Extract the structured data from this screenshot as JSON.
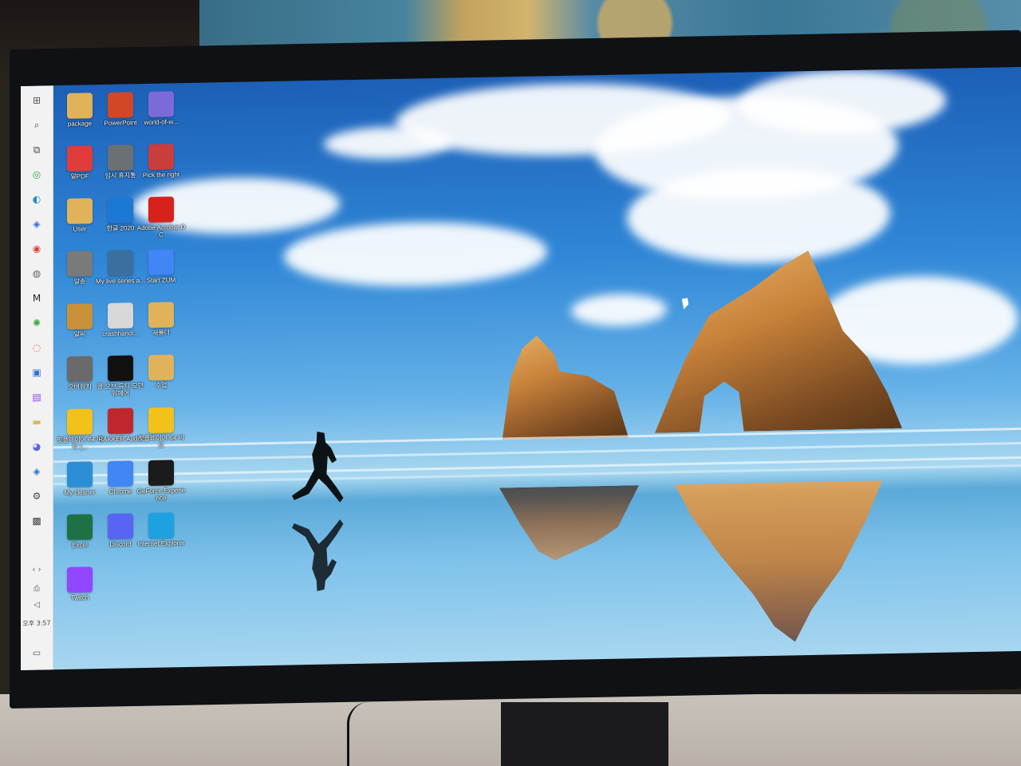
{
  "desktop": {
    "icons": [
      {
        "label": "package",
        "icon": "folder-icon",
        "color": "#e0b35a"
      },
      {
        "label": "PowerPoint",
        "icon": "powerpoint-icon",
        "color": "#d24726"
      },
      {
        "label": "world-of-w...",
        "icon": "browser-shield-icon",
        "color": "#7b6bd8"
      },
      {
        "label": "알PDF",
        "icon": "alpdf-icon",
        "color": "#e23b3b"
      },
      {
        "label": "임시 휴지통",
        "icon": "recycle-bin-icon",
        "color": "#6b7075"
      },
      {
        "label": "Pick the right",
        "icon": "game-shortcut-icon",
        "color": "#c93d3d"
      },
      {
        "label": "User",
        "icon": "user-folder-icon",
        "color": "#e0b35a"
      },
      {
        "label": "한글 2020",
        "icon": "hangul-icon",
        "color": "#1d78d4"
      },
      {
        "label": "Adobe Acrobat DC",
        "icon": "acrobat-icon",
        "color": "#d7211b"
      },
      {
        "label": "알송",
        "icon": "alsong-icon",
        "color": "#7a7a7a"
      },
      {
        "label": "My live series a...",
        "icon": "video-icon",
        "color": "#3a6fa0"
      },
      {
        "label": "Start ZUM",
        "icon": "chrome-icon",
        "color": "#4285f4"
      },
      {
        "label": "알씨",
        "icon": "alsee-icon",
        "color": "#c9923a"
      },
      {
        "label": "crashhandl...",
        "icon": "file-icon",
        "color": "#d8d8d8"
      },
      {
        "label": "새폴더",
        "icon": "folder-icon",
        "color": "#e0b35a"
      },
      {
        "label": "오버워치",
        "icon": "overwatch-icon",
        "color": "#6a6a6a"
      },
      {
        "label": "콜 오브 듀티 모던 워페어",
        "icon": "mw-icon",
        "color": "#111111"
      },
      {
        "label": "수업",
        "icon": "folder-icon",
        "color": "#e0b35a"
      },
      {
        "label": "팟플레이어 64 비트 (...",
        "icon": "potplayer-icon",
        "color": "#f2c21b"
      },
      {
        "label": "RAKKER Audio",
        "icon": "rakker-audio-icon",
        "color": "#c0262d"
      },
      {
        "label": "팟플레이어 64 비트",
        "icon": "potplayer-icon",
        "color": "#f2c21b"
      },
      {
        "label": "My cleaner",
        "icon": "broom-icon",
        "color": "#2c8fd6"
      },
      {
        "label": "Chrome",
        "icon": "chrome-icon",
        "color": "#4285f4"
      },
      {
        "label": "GeForce Experience",
        "icon": "geforce-icon",
        "color": "#1b1b1b"
      },
      {
        "label": "Excel",
        "icon": "excel-icon",
        "color": "#1e7145"
      },
      {
        "label": "Discord",
        "icon": "discord-icon",
        "color": "#5865f2"
      },
      {
        "label": "Internet Explorer",
        "icon": "ie-icon",
        "color": "#1ea1e0"
      },
      {
        "label": "Twitch",
        "icon": "twitch-icon",
        "color": "#9146ff"
      }
    ]
  },
  "taskbar": {
    "clock": "오후 3:57",
    "items": [
      {
        "name": "start-icon",
        "glyph": "⊞",
        "color": "#555"
      },
      {
        "name": "search-icon",
        "glyph": "⌕",
        "color": "#555"
      },
      {
        "name": "task-view-icon",
        "glyph": "⧉",
        "color": "#555"
      },
      {
        "name": "app-green-icon",
        "glyph": "◎",
        "color": "#2faa3f"
      },
      {
        "name": "edge-icon",
        "glyph": "◐",
        "color": "#1f8ad8"
      },
      {
        "name": "app-blue-icon",
        "glyph": "◈",
        "color": "#2e6fd8"
      },
      {
        "name": "chrome-icon",
        "glyph": "◉",
        "color": "#db4437"
      },
      {
        "name": "overwatch-icon",
        "glyph": "◍",
        "color": "#666"
      },
      {
        "name": "mw-icon",
        "glyph": "M",
        "color": "#222"
      },
      {
        "name": "razer-icon",
        "glyph": "✺",
        "color": "#3aa83a"
      },
      {
        "name": "browser-shield-icon",
        "glyph": "◌",
        "color": "#d85a2a"
      },
      {
        "name": "window-icon",
        "glyph": "▣",
        "color": "#2e6fd8"
      },
      {
        "name": "twitch-icon",
        "glyph": "▤",
        "color": "#9146ff"
      },
      {
        "name": "file-explorer-icon",
        "glyph": "▬",
        "color": "#e0b35a"
      },
      {
        "name": "discord-icon",
        "glyph": "◕",
        "color": "#5865f2"
      },
      {
        "name": "app-blue2-icon",
        "glyph": "◈",
        "color": "#2e6fd8"
      },
      {
        "name": "settings-icon",
        "glyph": "⚙",
        "color": "#444"
      },
      {
        "name": "war-thunder-icon",
        "glyph": "▩",
        "color": "#444"
      }
    ]
  }
}
